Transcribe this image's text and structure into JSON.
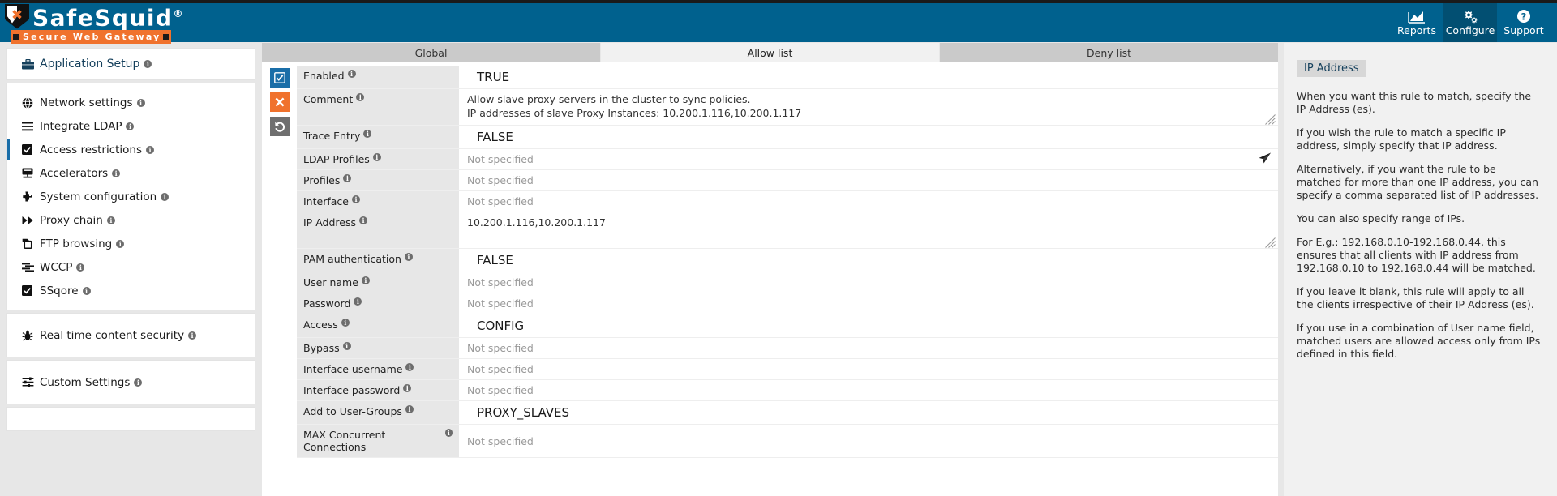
{
  "brand": {
    "name": "SafeSquid",
    "registered": "®",
    "tagline": "Secure Web Gateway",
    "shield_glyph": "✖"
  },
  "topnav": {
    "items": [
      {
        "label": "Reports",
        "icon": "chart-area-icon",
        "active": false
      },
      {
        "label": "Configure",
        "icon": "gears-icon",
        "active": true
      },
      {
        "label": "Support",
        "icon": "question-circle-icon",
        "active": false
      }
    ]
  },
  "sidebar": {
    "header": {
      "label": "Application Setup",
      "icon": "briefcase-icon",
      "info": "i"
    },
    "groups": [
      {
        "items": [
          {
            "label": "Network settings",
            "icon": "globe-icon",
            "active": false
          },
          {
            "label": "Integrate LDAP",
            "icon": "list-icon",
            "active": false
          },
          {
            "label": "Access restrictions",
            "icon": "checkbox-icon",
            "active": true
          },
          {
            "label": "Accelerators",
            "icon": "server-icon",
            "active": false
          },
          {
            "label": "System configuration",
            "icon": "puzzle-icon",
            "active": false
          },
          {
            "label": "Proxy chain",
            "icon": "forward-icon",
            "active": false
          },
          {
            "label": "FTP browsing",
            "icon": "copy-icon",
            "active": false
          },
          {
            "label": "WCCP",
            "icon": "stream-icon",
            "active": false
          },
          {
            "label": "SSqore",
            "icon": "checkbox-icon",
            "active": false
          }
        ]
      },
      {
        "items": [
          {
            "label": "Real time content security",
            "icon": "bug-icon",
            "active": false
          }
        ]
      },
      {
        "items": [
          {
            "label": "Custom Settings",
            "icon": "sliders-icon",
            "active": false
          }
        ]
      }
    ]
  },
  "main": {
    "tabs": [
      {
        "label": "Global",
        "active": false
      },
      {
        "label": "Allow list",
        "active": true
      },
      {
        "label": "Deny list",
        "active": false
      }
    ],
    "actions": [
      {
        "name": "apply",
        "icon": "checkbox-check-icon",
        "color": "#1a6ea8"
      },
      {
        "name": "delete",
        "icon": "times-icon",
        "color": "#f0722d"
      },
      {
        "name": "undo",
        "icon": "undo-icon",
        "color": "#6f6f6f"
      }
    ],
    "not_specified": "Not specified",
    "fields": [
      {
        "label": "Enabled",
        "value": "TRUE",
        "style": "big",
        "height": "h26"
      },
      {
        "label": "Comment",
        "value": "Allow slave proxy servers in the cluster to sync policies.\nIP addresses of slave Proxy Instances: 10.200.1.116,10.200.1.117",
        "style": "multiline",
        "height": "h44",
        "resize": true
      },
      {
        "label": "Trace Entry",
        "value": "FALSE",
        "style": "big",
        "height": "h26"
      },
      {
        "label": "LDAP Profiles",
        "value": "Not specified",
        "style": "muted",
        "height": "h22",
        "send": true
      },
      {
        "label": "Profiles",
        "value": "Not specified",
        "style": "muted",
        "height": "h22"
      },
      {
        "label": "Interface",
        "value": "Not specified",
        "style": "muted",
        "height": "h22"
      },
      {
        "label": "IP Address",
        "value": "10.200.1.116,10.200.1.117",
        "style": "plain",
        "height": "h44",
        "resize": true
      },
      {
        "label": "PAM authentication",
        "value": "FALSE",
        "style": "big",
        "height": "h26"
      },
      {
        "label": "User name",
        "value": "Not specified",
        "style": "muted",
        "height": "h22"
      },
      {
        "label": "Password",
        "value": "Not specified",
        "style": "muted",
        "height": "h22"
      },
      {
        "label": "Access",
        "value": "CONFIG",
        "style": "big",
        "height": "h26"
      },
      {
        "label": "Bypass",
        "value": "Not specified",
        "style": "muted",
        "height": "h22"
      },
      {
        "label": "Interface username",
        "value": "Not specified",
        "style": "muted",
        "height": "h22"
      },
      {
        "label": "Interface password",
        "value": "Not specified",
        "style": "muted",
        "height": "h22"
      },
      {
        "label": "Add to User-Groups",
        "value": "PROXY_SLAVES",
        "style": "big",
        "height": "h26"
      },
      {
        "label": "MAX Concurrent Connections",
        "value": "Not specified",
        "style": "muted",
        "height": "h22"
      }
    ]
  },
  "help": {
    "title": "IP Address",
    "paragraphs": [
      "When you want this rule to match, specify the IP Address (es).",
      "If you wish the rule to match a specific IP address, simply specify that IP address.",
      "Alternatively, if you want the rule to be matched for more than one IP address, you can specify a comma separated list of IP addresses.",
      "You can also specify range of IPs.",
      "For E.g.: 192.168.0.10-192.168.0.44, this ensures that all clients with IP address from 192.168.0.10 to 192.168.0.44 will be matched.",
      "If you leave it blank, this rule will apply to all the clients irrespective of their IP Address (es).",
      "If you use in a combination of User name field, matched users are allowed access only from IPs defined in this field."
    ]
  },
  "colors": {
    "brand_blue": "#00618e",
    "accent_orange": "#f0722d",
    "active_nav": "#024f72",
    "sidebar_active": "#1a6ea8",
    "page_bg": "#e7e7e7"
  }
}
